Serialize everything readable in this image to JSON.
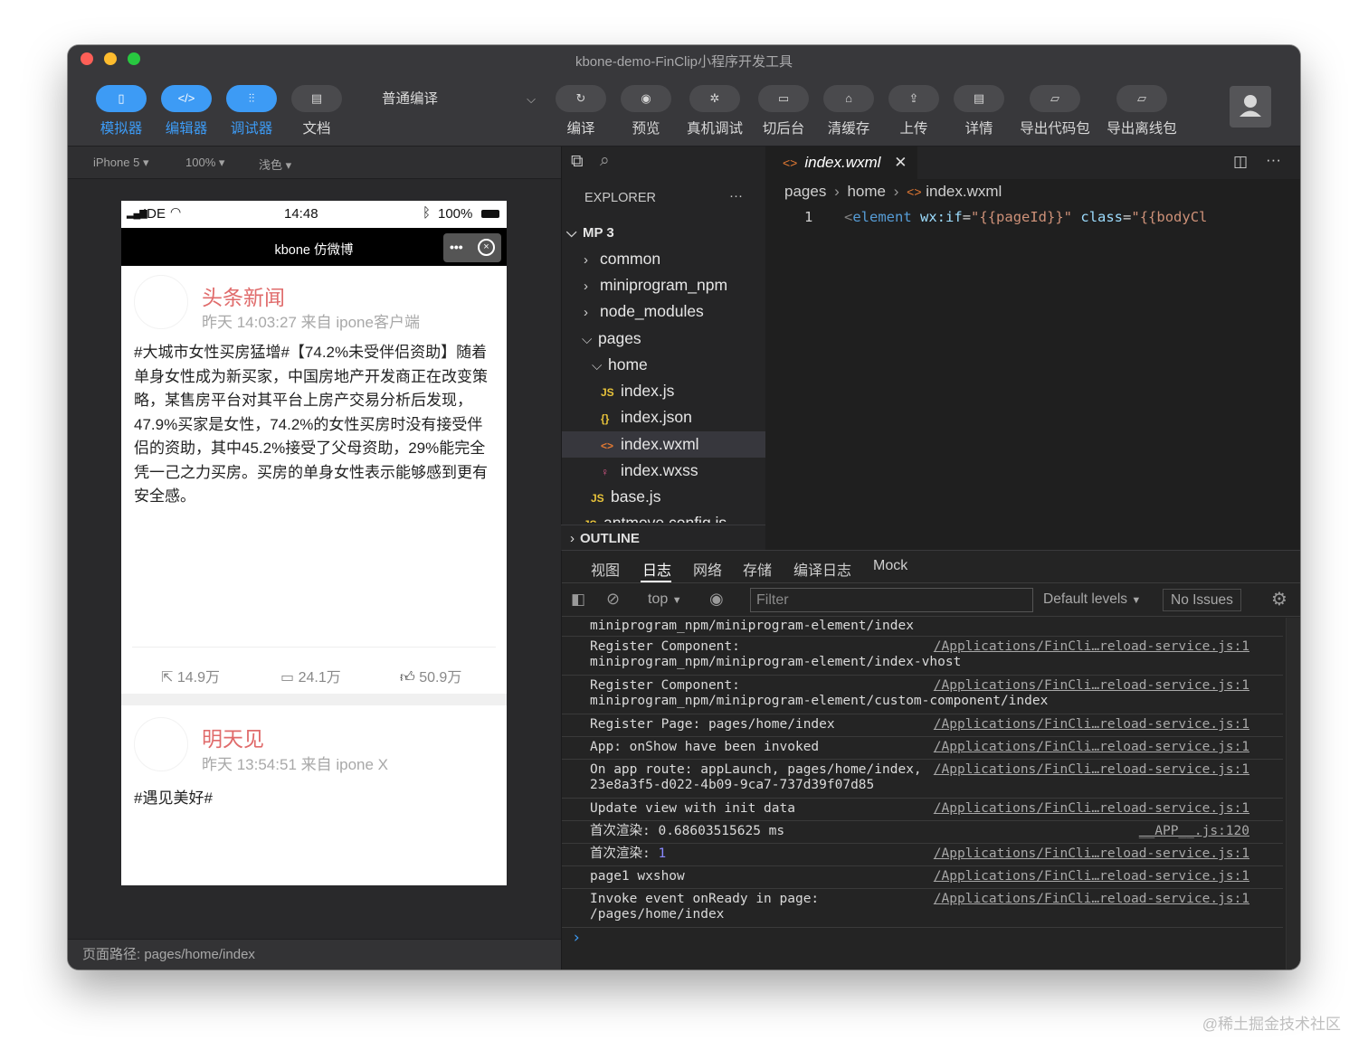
{
  "window": {
    "title": "kbone-demo-FinClip小程序开发工具"
  },
  "toolbar": {
    "left": [
      {
        "label": "模拟器",
        "icon": "phone-icon",
        "active": true
      },
      {
        "label": "编辑器",
        "icon": "code-icon",
        "active": true
      },
      {
        "label": "调试器",
        "icon": "sliders-icon",
        "active": true
      },
      {
        "label": "文档",
        "icon": "document-icon",
        "active": false
      }
    ],
    "compile_mode": "普通编译",
    "right": [
      {
        "label": "编译",
        "icon": "refresh-icon"
      },
      {
        "label": "预览",
        "icon": "eye-icon"
      },
      {
        "label": "真机调试",
        "icon": "bug-icon"
      },
      {
        "label": "切后台",
        "icon": "window-icon"
      },
      {
        "label": "清缓存",
        "icon": "clear-cache-icon"
      },
      {
        "label": "上传",
        "icon": "upload-icon"
      },
      {
        "label": "详情",
        "icon": "details-icon"
      },
      {
        "label": "导出代码包",
        "icon": "folder-icon"
      },
      {
        "label": "导出离线包",
        "icon": "folder-icon"
      }
    ]
  },
  "simulator": {
    "device": "iPhone 5",
    "zoom": "100%",
    "theme": "浅色",
    "status_bar": {
      "carrier": "IDE",
      "time": "14:48",
      "battery": "100%"
    },
    "nav_title": "kbone 仿微博",
    "posts": [
      {
        "name": "头条新闻",
        "meta": "昨天 14:03:27 来自 ipone客户端",
        "body": "#大城市女性买房猛增#【74.2%未受伴侣资助】随着单身女性成为新买家，中国房地产开发商正在改变策略，某售房平台对其平台上房产交易分析后发现，47.9%买家是女性，74.2%的女性买房时没有接受伴侣的资助，其中45.2%接受了父母资助，29%能完全凭一己之力买房。买房的单身女性表示能够感到更有安全感。",
        "shares": "14.9万",
        "comments": "24.1万",
        "likes": "50.9万"
      },
      {
        "name": "明天见",
        "meta": "昨天 13:54:51 来自 ipone X",
        "body": "#遇见美好#"
      }
    ],
    "page_path": "页面路径: pages/home/index"
  },
  "explorer": {
    "title": "EXPLORER",
    "root": "MP 3",
    "items": [
      {
        "label": "common",
        "type": "folder",
        "open": false,
        "depth": 1
      },
      {
        "label": "miniprogram_npm",
        "type": "folder",
        "open": false,
        "depth": 1
      },
      {
        "label": "node_modules",
        "type": "folder",
        "open": false,
        "depth": 1
      },
      {
        "label": "pages",
        "type": "folder",
        "open": true,
        "depth": 1
      },
      {
        "label": "home",
        "type": "folder",
        "open": true,
        "depth": 2
      },
      {
        "label": "index.js",
        "type": "js",
        "depth": 3
      },
      {
        "label": "index.json",
        "type": "json",
        "depth": 3
      },
      {
        "label": "index.wxml",
        "type": "wxml",
        "depth": 3,
        "selected": true
      },
      {
        "label": "index.wxss",
        "type": "wxss",
        "depth": 3
      },
      {
        "label": "base.js",
        "type": "js",
        "depth": 2
      },
      {
        "label": "antmove.config.js",
        "type": "js",
        "depth": 1
      }
    ],
    "outline": "OUTLINE"
  },
  "editor": {
    "tab": "index.wxml",
    "breadcrumb": [
      "pages",
      "home",
      "index.wxml"
    ],
    "line_number": "1",
    "code": {
      "tag_open": "<",
      "tag": "element",
      "attr1": "wx:if",
      "val1": "\"{{pageId}}\"",
      "attr2": "class",
      "val2": "\"{{bodyCl"
    }
  },
  "devtools": {
    "tabs": [
      "视图",
      "日志",
      "网络",
      "存储",
      "编译日志",
      "Mock"
    ],
    "active_tab": "日志",
    "context": "top",
    "filter_placeholder": "Filter",
    "levels": "Default levels",
    "issues": "No Issues",
    "logs": [
      {
        "msg": "miniprogram_npm/miniprogram-element/index",
        "link": ""
      },
      {
        "msg": "Register Component:\nminiprogram_npm/miniprogram-element/index-vhost",
        "link": "/Applications/FinCli…reload-service.js:1"
      },
      {
        "msg": "Register Component:\nminiprogram_npm/miniprogram-element/custom-component/index",
        "link": "/Applications/FinCli…reload-service.js:1"
      },
      {
        "msg": "Register Page: pages/home/index",
        "link": "/Applications/FinCli…reload-service.js:1"
      },
      {
        "msg": "App: onShow have been invoked",
        "link": "/Applications/FinCli…reload-service.js:1"
      },
      {
        "msg": "On app route: appLaunch, pages/home/index,\n23e8a3f5-d022-4b09-9ca7-737d39f07d85",
        "link": "/Applications/FinCli…reload-service.js:1"
      },
      {
        "msg": "Update view with init data",
        "link": "/Applications/FinCli…reload-service.js:1"
      },
      {
        "msg": "首次渲染: 0.68603515625 ms",
        "link": "__APP__.js:120"
      },
      {
        "msg": "首次渲染: ",
        "num": "1",
        "link": "/Applications/FinCli…reload-service.js:1"
      },
      {
        "msg": "page1 wxshow",
        "link": "/Applications/FinCli…reload-service.js:1"
      },
      {
        "msg": "Invoke event onReady in page:\n/pages/home/index",
        "link": "/Applications/FinCli…reload-service.js:1"
      }
    ],
    "prompt": "›"
  },
  "watermark": "@稀土掘金技术社区",
  "colors": {
    "accent": "#3d9bf5",
    "post_name": "#e06b6b",
    "code_tag": "#569cd6",
    "code_attr": "#9cdcfe",
    "code_string": "#ce9178"
  }
}
